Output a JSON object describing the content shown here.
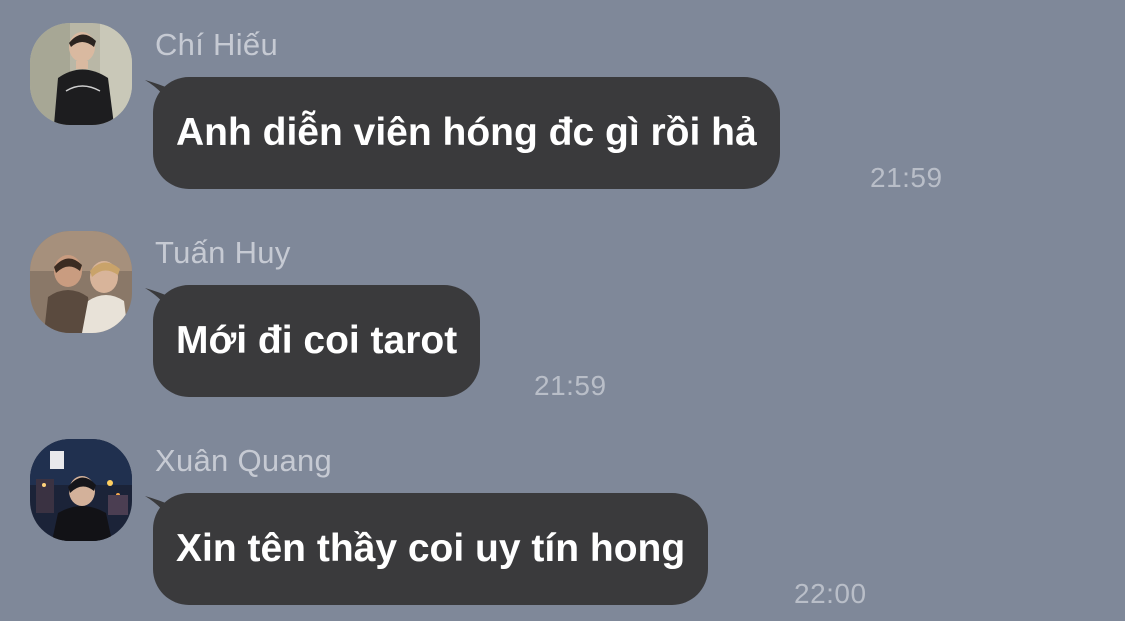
{
  "colors": {
    "background": "#7f8899",
    "bubble": "#3a3a3c",
    "bubble_text": "#ffffff",
    "sender_text": "#c6cad3",
    "time_text": "#b9bec8"
  },
  "messages": [
    {
      "sender": "Chí Hiếu",
      "text": "Anh diễn viên hóng đc gì rồi hả",
      "time": "21:59",
      "avatar": "avatar-photo-man-black-tshirt"
    },
    {
      "sender": "Tuấn Huy",
      "text": "Mới đi coi tarot",
      "time": "21:59",
      "avatar": "avatar-photo-two-people"
    },
    {
      "sender": "Xuân Quang",
      "text": "Xin tên thầy coi uy tín hong",
      "time": "22:00",
      "avatar": "avatar-photo-city-night"
    }
  ]
}
